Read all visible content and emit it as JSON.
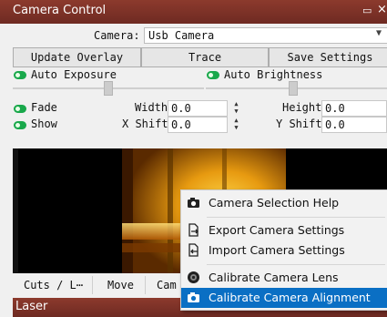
{
  "window": {
    "title": "Camera Control"
  },
  "camera_select": {
    "label": "Camera:",
    "value": "Usb Camera"
  },
  "buttons": {
    "update_overlay": "Update Overlay",
    "trace": "Trace",
    "save_settings": "Save Settings"
  },
  "toggles": {
    "auto_exposure": "Auto Exposure",
    "auto_brightness": "Auto Brightness",
    "fade": "Fade",
    "show": "Show"
  },
  "fields": {
    "width_label": "Width",
    "width_value": "0.0",
    "height_label": "Height",
    "height_value": "0.0",
    "xshift_label": "X Shift",
    "xshift_value": "0.0",
    "yshift_label": "Y Shift",
    "yshift_value": "0.0"
  },
  "tabs": [
    "Cuts / L⋯",
    "Move",
    "Cam"
  ],
  "bottom_panel": {
    "title": "Laser"
  },
  "context_menu": {
    "items": [
      {
        "label": "Camera Selection Help",
        "icon": "camera-icon"
      },
      {
        "label": "Export Camera Settings",
        "icon": "export-icon"
      },
      {
        "label": "Import Camera Settings",
        "icon": "import-icon"
      },
      {
        "label": "Calibrate Camera Lens",
        "icon": "lens-icon"
      },
      {
        "label": "Calibrate Camera Alignment",
        "icon": "camera-icon",
        "selected": true
      }
    ]
  },
  "colors": {
    "title_bar": "#7a3027",
    "toggle_on": "#19a84b",
    "menu_highlight": "#0a6fc4"
  }
}
